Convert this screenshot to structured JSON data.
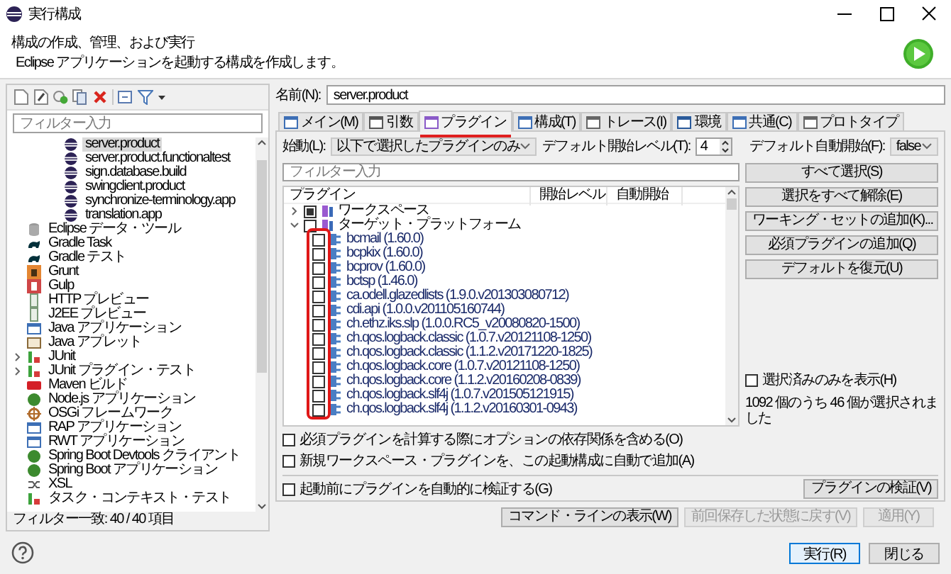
{
  "window": {
    "title": "実行構成"
  },
  "header": {
    "title": "構成の作成、管理、および実行",
    "description": "Eclipse アプリケーションを起動する構成を作成します。"
  },
  "sidebar": {
    "filter": {
      "placeholder": "フィルター入力"
    },
    "tree": [
      {
        "children": [
          {
            "label": "server.product",
            "selected": true
          },
          {
            "label": "server.product.functionaltest",
            "selected": false
          },
          {
            "label": "sign.database.build",
            "selected": false
          },
          {
            "label": "swingclient.product",
            "selected": false
          },
          {
            "label": "synchronize-terminology.app",
            "selected": false
          },
          {
            "label": "translation.app",
            "selected": false
          }
        ]
      },
      {
        "label": "Eclipse データ・ツール",
        "selected": false
      },
      {
        "label": "Gradle Task",
        "selected": false
      },
      {
        "label": "Gradle テスト",
        "selected": false
      },
      {
        "label": "Grunt",
        "selected": false
      },
      {
        "label": "Gulp",
        "selected": false
      },
      {
        "label": "HTTP プレビュー",
        "selected": false
      },
      {
        "label": "J2EE プレビュー",
        "selected": false
      },
      {
        "label": "Java アプリケーション",
        "selected": false
      },
      {
        "label": "Java アプレット",
        "selected": false
      },
      {
        "label": "JUnit",
        "selected": false,
        "expanded": false
      },
      {
        "label": "JUnit プラグイン・テスト",
        "selected": false,
        "expanded": false
      },
      {
        "label": "Maven ビルド",
        "selected": false
      },
      {
        "label": "Node.js アプリケーション",
        "selected": false
      },
      {
        "label": "OSGi フレームワーク",
        "selected": false
      },
      {
        "label": "RAP アプリケーション",
        "selected": false
      },
      {
        "label": "RWT アプリケーション",
        "selected": false
      },
      {
        "label": "Spring Boot Devtools クライアント",
        "selected": false
      },
      {
        "label": "Spring Boot アプリケーション",
        "selected": false
      },
      {
        "label": "XSL",
        "selected": false
      },
      {
        "label": "タスク・コンテキスト・テスト",
        "selected": false
      }
    ],
    "status": "フィルター一致: 40 / 40 項目"
  },
  "name": {
    "label": "名前(N):",
    "value": "server.product"
  },
  "tabs": [
    {
      "label": "メイン(M)",
      "selected": false
    },
    {
      "label": "引数",
      "selected": false
    },
    {
      "label": "プラグイン",
      "selected": true
    },
    {
      "label": "構成(T)",
      "selected": false
    },
    {
      "label": "トレース(I)",
      "selected": false
    },
    {
      "label": "環境",
      "selected": false
    },
    {
      "label": "共通(C)",
      "selected": false
    },
    {
      "label": "プロトタイプ",
      "selected": false
    }
  ],
  "launch_with": {
    "label": "始動(L):",
    "value": "以下で選択したプラグインのみ"
  },
  "default_start_level": {
    "label": "デフォルト開始レベル(T):",
    "value": "4"
  },
  "default_auto_start": {
    "label": "デフォルト自動開始(F):",
    "value": "false"
  },
  "plugin_filter": {
    "placeholder": "フィルター入力"
  },
  "plugins": {
    "columns": [
      "プラグイン",
      "開始レベル",
      "自動開始"
    ],
    "tree": [
      {
        "label": "ワークスペース",
        "checked": true,
        "grayed": true,
        "expanded": false
      },
      {
        "label": "ターゲット・プラットフォーム",
        "checked": false,
        "grayed": false,
        "expanded": true,
        "children": [
          {
            "label": "bcmail (1.60.0)",
            "checked": false
          },
          {
            "label": "bcpkix (1.60.0)",
            "checked": false
          },
          {
            "label": "bcprov (1.60.0)",
            "checked": false
          },
          {
            "label": "bctsp (1.46.0)",
            "checked": false
          },
          {
            "label": "ca.odell.glazedlists (1.9.0.v201303080712)",
            "checked": false
          },
          {
            "label": "cdi.api (1.0.0.v201105160744)",
            "checked": false
          },
          {
            "label": "ch.ethz.iks.slp (1.0.0.RC5_v20080820-1500)",
            "checked": false
          },
          {
            "label": "ch.qos.logback.classic (1.0.7.v20121108-1250)",
            "checked": false
          },
          {
            "label": "ch.qos.logback.classic (1.1.2.v20171220-1825)",
            "checked": false
          },
          {
            "label": "ch.qos.logback.core (1.0.7.v20121108-1250)",
            "checked": false
          },
          {
            "label": "ch.qos.logback.core (1.1.2.v20160208-0839)",
            "checked": false
          },
          {
            "label": "ch.qos.logback.slf4j (1.0.7.v201505121915)",
            "checked": false
          },
          {
            "label": "ch.qos.logback.slf4j (1.1.2.v20160301-0943)",
            "checked": false
          }
        ]
      }
    ]
  },
  "side_buttons": [
    "すべて選択(S)",
    "選択をすべて解除(E)",
    "ワーキング・セットの追加(K)...",
    "必須プラグインの追加(Q)",
    "デフォルトを復元(U)"
  ],
  "show_selected_only": {
    "label": "選択済みのみを表示(H)",
    "checked": false
  },
  "selection_count": "1092 個のうち 46 個が選択されました",
  "options": [
    {
      "label": "必須プラグインを計算する際にオプションの依存関係を含める(O)",
      "checked": false
    },
    {
      "label": "新規ワークスペース・プラグインを、この起動構成に自動で追加(A)",
      "checked": false
    }
  ],
  "validate": {
    "label": "起動前にプラグインを自動的に検証する(G)",
    "checked": false,
    "button": "プラグインの検証(V)"
  },
  "actions": [
    {
      "label": "コマンド・ラインの表示(W)",
      "disabled": false
    },
    {
      "label": "前回保存した状態に戻す(V)",
      "disabled": true
    },
    {
      "label": "適用(Y)",
      "disabled": true
    }
  ],
  "dialog_buttons": [
    {
      "label": "実行(R)",
      "default": true
    },
    {
      "label": "閉じる",
      "default": false
    }
  ]
}
